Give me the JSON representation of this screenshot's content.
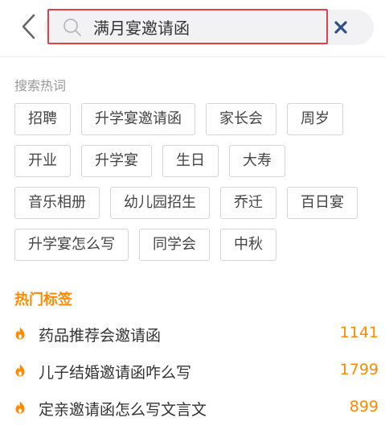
{
  "search": {
    "value": "满月宴邀请函"
  },
  "hot_search": {
    "title": "搜索热词",
    "rows": [
      [
        "招聘",
        "升学宴邀请函",
        "家长会",
        "周岁"
      ],
      [
        "开业",
        "升学宴",
        "生日",
        "大寿"
      ],
      [
        "音乐相册",
        "幼儿园招生",
        "乔迁",
        "百日宴"
      ],
      [
        "升学宴怎么写",
        "同学会",
        "中秋"
      ]
    ]
  },
  "popular": {
    "title": "热门标签",
    "items": [
      {
        "label": "药品推荐会邀请函",
        "count": "1141"
      },
      {
        "label": "儿子结婚邀请函咋么写",
        "count": "1799"
      },
      {
        "label": "定亲邀请函怎么写文言文",
        "count": "899"
      }
    ]
  },
  "colors": {
    "accent": "#ff8a00",
    "focus_border": "#e04048",
    "clear_icon": "#2f4f8c"
  },
  "icons": [
    "back-arrow-icon",
    "search-icon",
    "clear-icon",
    "flame-icon"
  ]
}
